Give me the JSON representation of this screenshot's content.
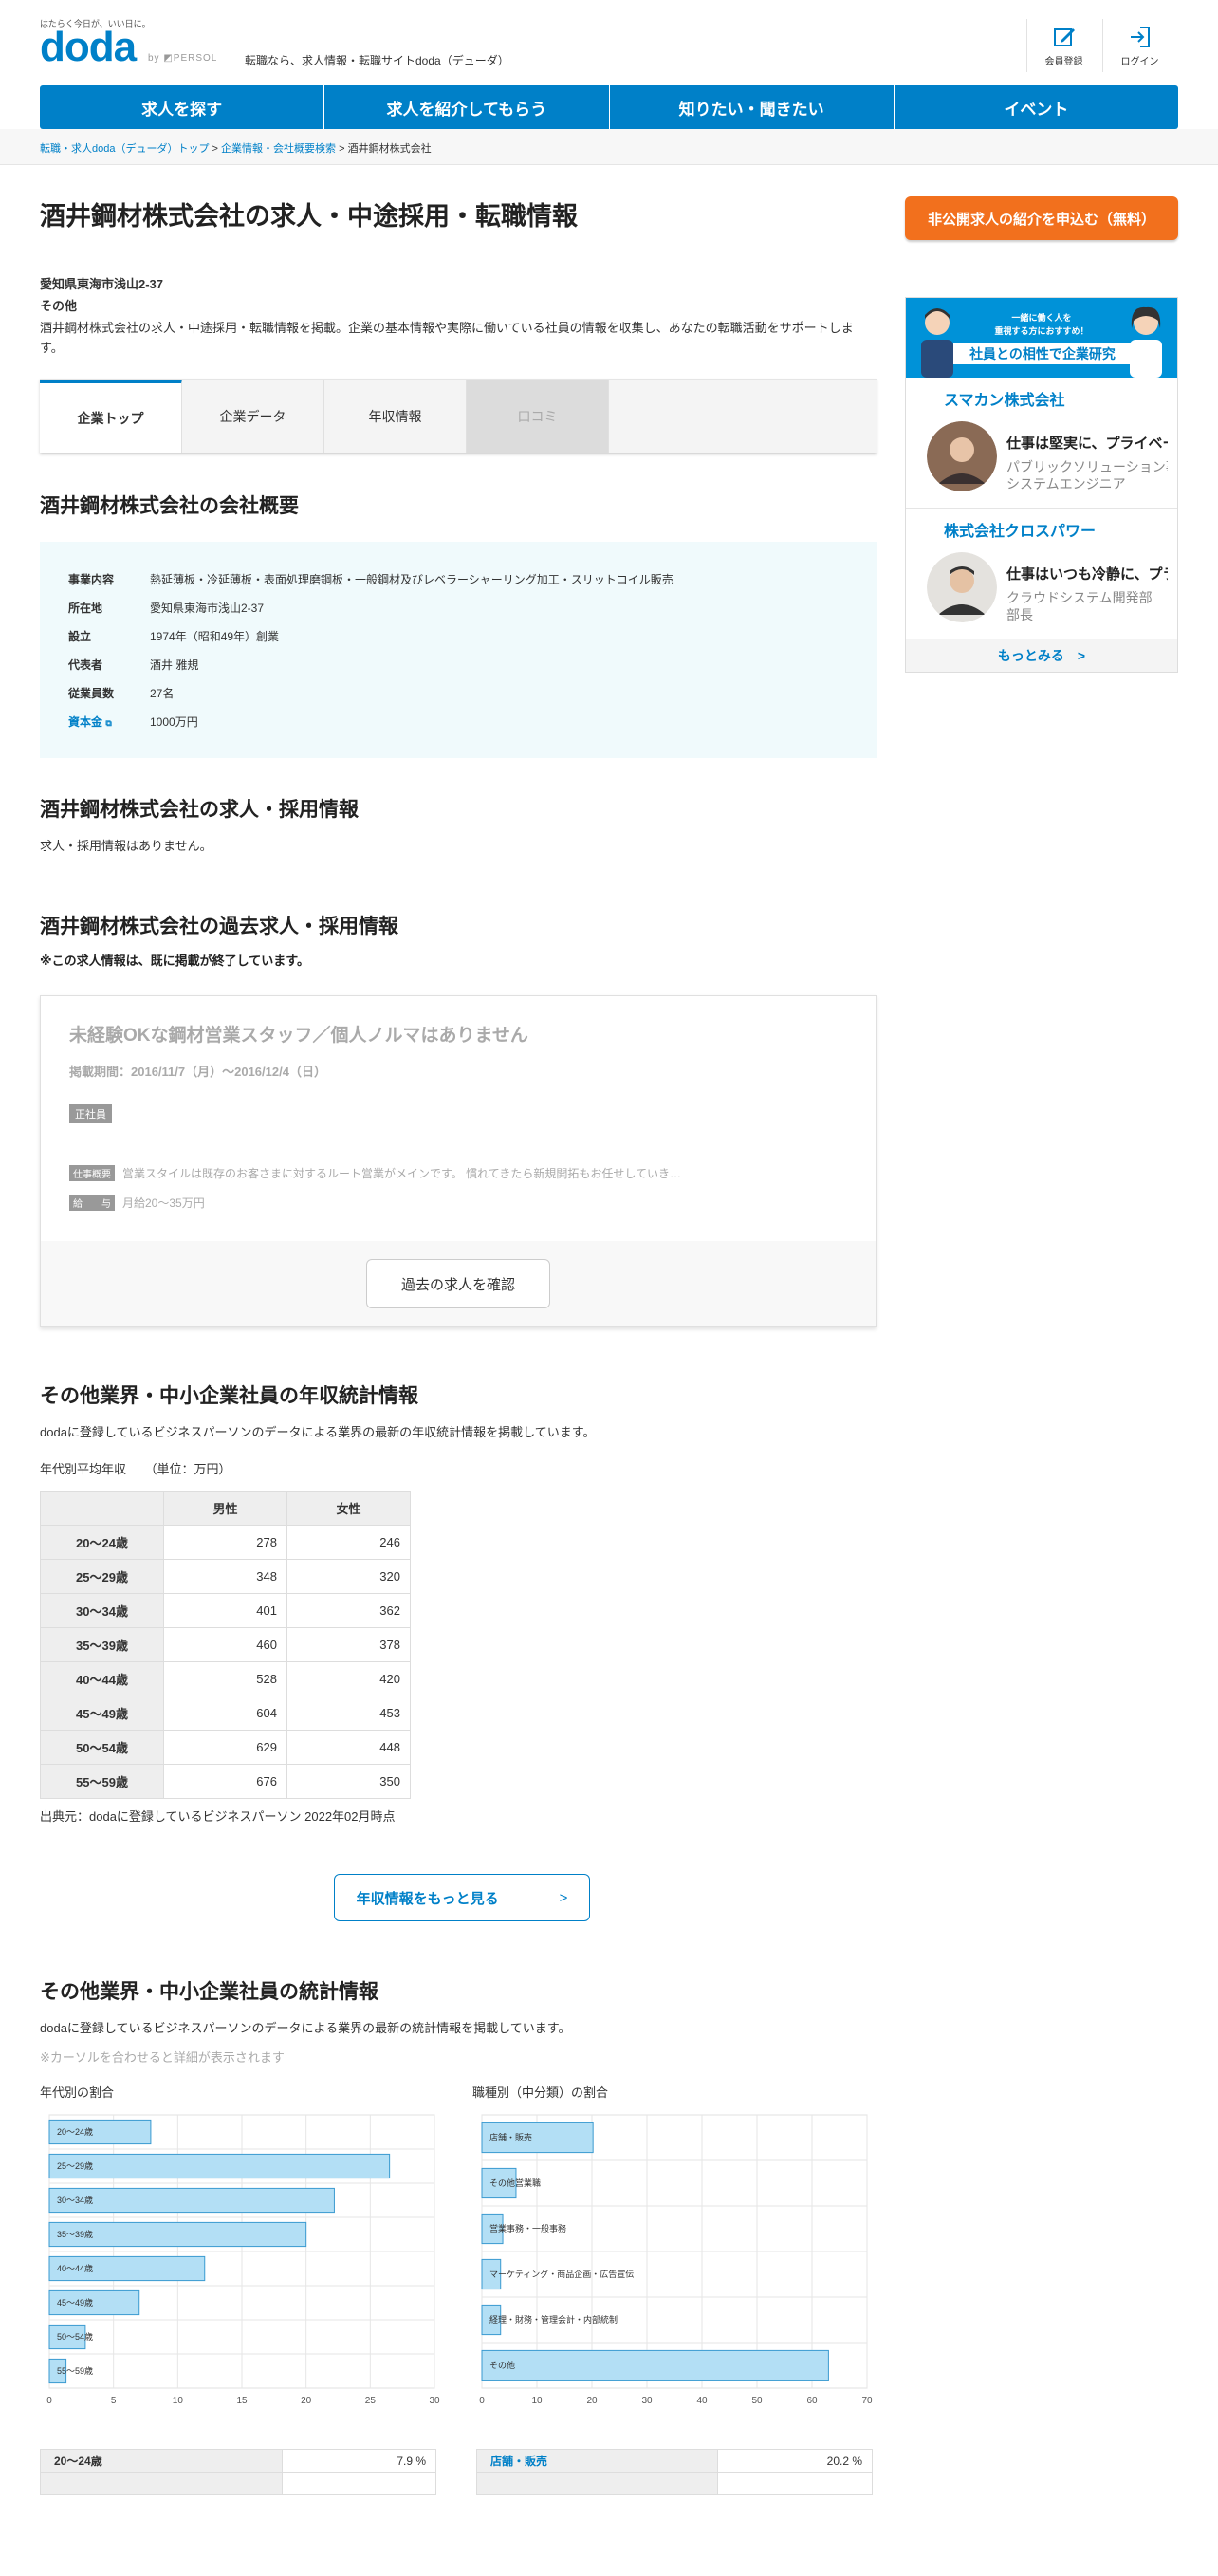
{
  "header": {
    "tagline_small": "はたらく今日が、いい日に。",
    "logo": "doda",
    "logo_by": "by ◩PERSOL",
    "tagline": "転職なら、求人情報・転職サイトdoda（デューダ）",
    "register": "会員登録",
    "login": "ログイン"
  },
  "nav": [
    "求人を探す",
    "求人を紹介してもらう",
    "知りたい・聞きたい",
    "イベント"
  ],
  "breadcrumb": [
    "転職・求人doda（デューダ）トップ",
    "企業情報・会社概要検索",
    "酒井鋼材株式会社"
  ],
  "page": {
    "title": "酒井鋼材株式会社の求人・中途採用・転職情報",
    "address": "愛知県東海市浅山2-37",
    "industry": "その他",
    "description": "酒井鋼材株式会社の求人・中途採用・転職情報を掲載。企業の基本情報や実際に働いている社員の情報を収集し、あなたの転職活動をサポートします。"
  },
  "tabs": [
    "企業トップ",
    "企業データ",
    "年収情報",
    "口コミ"
  ],
  "overview": {
    "title": "酒井鋼材株式会社の会社概要",
    "rows": [
      {
        "k": "事業内容",
        "v": "熱延薄板・冷延薄板・表面処理磨鋼板・一般鋼材及びレベラーシャーリング加工・スリットコイル販売"
      },
      {
        "k": "所在地",
        "v": "愛知県東海市浅山2-37"
      },
      {
        "k": "設立",
        "v": "1974年（昭和49年）創業"
      },
      {
        "k": "代表者",
        "v": "酒井 雅規"
      },
      {
        "k": "従業員数",
        "v": "27名"
      },
      {
        "k": "資本金",
        "v": "1000万円"
      }
    ]
  },
  "jobs": {
    "title": "酒井鋼材株式会社の求人・採用情報",
    "none": "求人・採用情報はありません。"
  },
  "past": {
    "title": "酒井鋼材株式会社の過去求人・採用情報",
    "note": "※この求人情報は、既に掲載が終了しています。",
    "job_title": "未経験OKな鋼材営業スタッフ／個人ノルマはありません",
    "period": "掲載期間：2016/11/7（月）～2016/12/4（日）",
    "tag": "正社員",
    "summary_label": "仕事概要",
    "summary": "営業スタイルは既存のお客さまに対するルート営業がメインです。 慣れてきたら新規開拓もお任せしていき…",
    "salary_label": "給　　与",
    "salary": "月給20～35万円",
    "button": "過去の求人を確認"
  },
  "salary": {
    "title": "その他業界・中小企業社員の年収統計情報",
    "intro": "dodaに登録しているビジネスパーソンのデータによる業界の最新の年収統計情報を掲載しています。",
    "caption": "年代別平均年収　　（単位：万円）",
    "col_male": "男性",
    "col_female": "女性",
    "rows": [
      {
        "age": "20～24歳",
        "m": "278",
        "f": "246"
      },
      {
        "age": "25～29歳",
        "m": "348",
        "f": "320"
      },
      {
        "age": "30～34歳",
        "m": "401",
        "f": "362"
      },
      {
        "age": "35～39歳",
        "m": "460",
        "f": "378"
      },
      {
        "age": "40～44歳",
        "m": "528",
        "f": "420"
      },
      {
        "age": "45～49歳",
        "m": "604",
        "f": "453"
      },
      {
        "age": "50～54歳",
        "m": "629",
        "f": "448"
      },
      {
        "age": "55～59歳",
        "m": "676",
        "f": "350"
      }
    ],
    "source": "出典元：dodaに登録しているビジネスパーソン 2022年02月時点",
    "more": "年収情報をもっと見る"
  },
  "stats": {
    "title": "その他業界・中小企業社員の統計情報",
    "intro": "dodaに登録しているビジネスパーソンのデータによる業界の最新の統計情報を掲載しています。",
    "hint": "※カーソルを合わせると詳細が表示されます",
    "left_label": "年代別の割合",
    "right_label": "職種別（中分類）の割合",
    "left_row_label": "20～24歳",
    "left_row_value": "7.9 %",
    "right_row_label": "店舗・販売",
    "right_row_value": "20.2 %"
  },
  "chart_data": [
    {
      "type": "bar",
      "orientation": "horizontal",
      "categories": [
        "20～24歳",
        "25～29歳",
        "30～34歳",
        "35～39歳",
        "40～44歳",
        "45～49歳",
        "50～54歳",
        "55～59歳"
      ],
      "values": [
        7.9,
        26.5,
        22.2,
        20.0,
        12.1,
        7.0,
        2.8,
        1.3
      ],
      "xlim": [
        0,
        30
      ],
      "xticks": [
        0,
        5,
        10,
        15,
        20,
        25,
        30
      ],
      "bar_color": "#b3dff5",
      "grid": true
    },
    {
      "type": "bar",
      "orientation": "horizontal",
      "categories": [
        "店舗・販売",
        "その他営業職",
        "営業事務・一般事務",
        "マーケティング・商品企画・広告宣伝",
        "経理・財務・管理会計・内部統制",
        "その他"
      ],
      "values": [
        20.2,
        6.2,
        3.8,
        3.4,
        3.4,
        63.0
      ],
      "xlim": [
        0,
        70
      ],
      "xticks": [
        0,
        10,
        20,
        30,
        40,
        50,
        60,
        70
      ],
      "bar_color": "#b3dff5",
      "grid": true
    }
  ],
  "sidebar": {
    "cta": "非公開求人の紹介を申込む（無料）",
    "banner_line1": "一緒に働く人を",
    "banner_line2": "重視する方におすすめ！",
    "banner_title": "社員との相性で企業研究",
    "companies": [
      {
        "name": "スマカン株式会社",
        "quote": "仕事は堅実に、プライベートは",
        "role1": "パブリックソリューション事業部",
        "role2": "システムエンジニア"
      },
      {
        "name": "株式会社クロスパワー",
        "quote": "仕事はいつも冷静に、プライベート",
        "role1": "クラウドシステム開発部",
        "role2": "部長"
      }
    ],
    "more": "もっとみる"
  },
  "colors": {
    "brand": "#0080c8",
    "cta": "#f2701d",
    "overview_bg": "#f0fafc"
  }
}
